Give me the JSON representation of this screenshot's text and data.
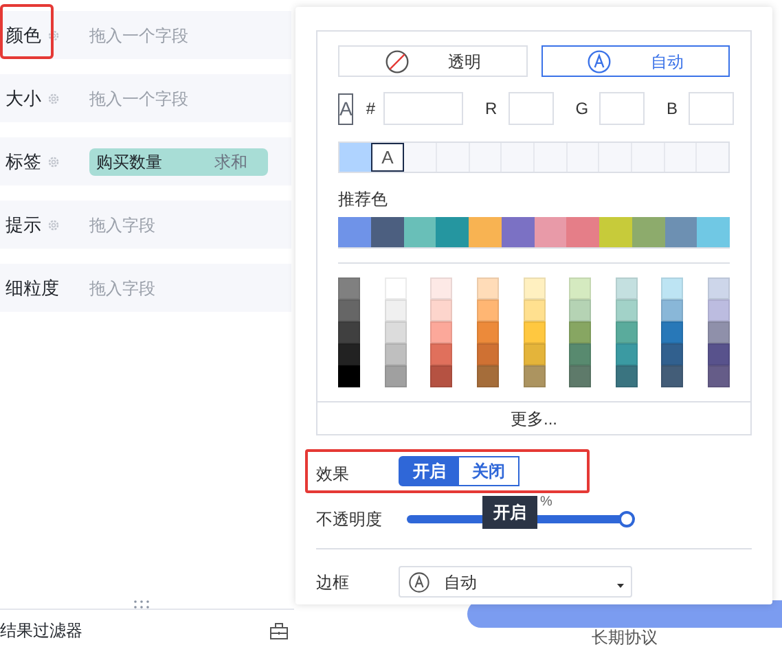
{
  "fields": [
    {
      "label": "颜色",
      "settings": true,
      "highlighted": true,
      "placeholder": "拖入一个字段"
    },
    {
      "label": "大小",
      "settings": true,
      "highlighted": false,
      "placeholder": "拖入一个字段"
    },
    {
      "label": "标签",
      "settings": true,
      "highlighted": false,
      "pill": {
        "field": "购买数量",
        "aggregate": "求和"
      }
    },
    {
      "label": "提示",
      "settings": true,
      "highlighted": false,
      "placeholder": "拖入字段"
    },
    {
      "label": "细粒度",
      "settings": false,
      "highlighted": false,
      "placeholder": "拖入字段"
    }
  ],
  "bottom_bar": {
    "label": "结果过滤器"
  },
  "background_button": {
    "label": "长期协议"
  },
  "color_popup": {
    "modes": [
      {
        "kind": "none",
        "label": "透明",
        "selected": false
      },
      {
        "kind": "auto",
        "label": "自动",
        "selected": true
      }
    ],
    "current_glyph": "A",
    "hex_label": "#",
    "channels": [
      {
        "label": "R"
      },
      {
        "label": "G"
      },
      {
        "label": "B"
      }
    ],
    "recent": [
      {
        "kind": "color",
        "color": "#afd3ff",
        "selected": false
      },
      {
        "kind": "auto",
        "glyph": "A",
        "selected": true
      }
    ],
    "recommended_title": "推荐色",
    "recommended": [
      {
        "color": "#6f93e8"
      },
      {
        "color": "#4c5f80"
      },
      {
        "color": "#69bfb8"
      },
      {
        "color": "#2596a0"
      },
      {
        "color": "#f8b352"
      },
      {
        "color": "#7b71c4"
      },
      {
        "color": "#e89aa8"
      },
      {
        "color": "#e57e88"
      },
      {
        "color": "#c7cb3a"
      },
      {
        "color": "#8dab6c"
      },
      {
        "color": "#6d90b2"
      },
      {
        "color": "#70c8e4"
      }
    ],
    "shade_columns": [
      {
        "cells": [
          {
            "color": "#808080"
          },
          {
            "color": "#666666"
          },
          {
            "color": "#404040"
          },
          {
            "color": "#222222"
          },
          {
            "color": "#000000"
          }
        ]
      },
      {
        "cells": [
          {
            "color": "#ffffff"
          },
          {
            "color": "#f0f0f0"
          },
          {
            "color": "#dcdcdc"
          },
          {
            "color": "#bfbfbf"
          },
          {
            "color": "#a0a0a0"
          }
        ]
      },
      {
        "cells": [
          {
            "color": "#fde9e6"
          },
          {
            "color": "#fdd5cc"
          },
          {
            "color": "#fca89a"
          },
          {
            "color": "#e0705c"
          },
          {
            "color": "#b55242"
          }
        ]
      },
      {
        "cells": [
          {
            "color": "#ffdcb8"
          },
          {
            "color": "#ffb673"
          },
          {
            "color": "#ec8a3a"
          },
          {
            "color": "#cf7133"
          },
          {
            "color": "#a56d3a"
          }
        ]
      },
      {
        "cells": [
          {
            "color": "#fff0c0"
          },
          {
            "color": "#ffe08f"
          },
          {
            "color": "#ffc840"
          },
          {
            "color": "#e4b43a"
          },
          {
            "color": "#ac9460"
          }
        ]
      },
      {
        "cells": [
          {
            "color": "#d5eac0"
          },
          {
            "color": "#b5d3b4"
          },
          {
            "color": "#87a662"
          },
          {
            "color": "#588a6f"
          },
          {
            "color": "#5e7a6a"
          }
        ]
      },
      {
        "cells": [
          {
            "color": "#c4e0e0"
          },
          {
            "color": "#a2d2c8"
          },
          {
            "color": "#5aab9c"
          },
          {
            "color": "#3b9aa2"
          },
          {
            "color": "#3a7480"
          }
        ]
      },
      {
        "cells": [
          {
            "color": "#bde4f3"
          },
          {
            "color": "#89b7d8"
          },
          {
            "color": "#2878b8"
          },
          {
            "color": "#31608e"
          },
          {
            "color": "#435d78"
          }
        ]
      },
      {
        "cells": [
          {
            "color": "#cdd6ea"
          },
          {
            "color": "#bcbce0"
          },
          {
            "color": "#8f90aa"
          },
          {
            "color": "#58528c"
          },
          {
            "color": "#655c88"
          }
        ]
      }
    ],
    "more": "更多..."
  },
  "effect": {
    "label": "效果",
    "highlighted": true,
    "options": [
      {
        "label": "开启",
        "selected": true
      },
      {
        "label": "关闭",
        "selected": false
      }
    ],
    "tooltip": "开启"
  },
  "opacity": {
    "label": "不透明度",
    "level": 1,
    "unit": "%"
  },
  "border": {
    "label": "边框",
    "value": "自动"
  }
}
